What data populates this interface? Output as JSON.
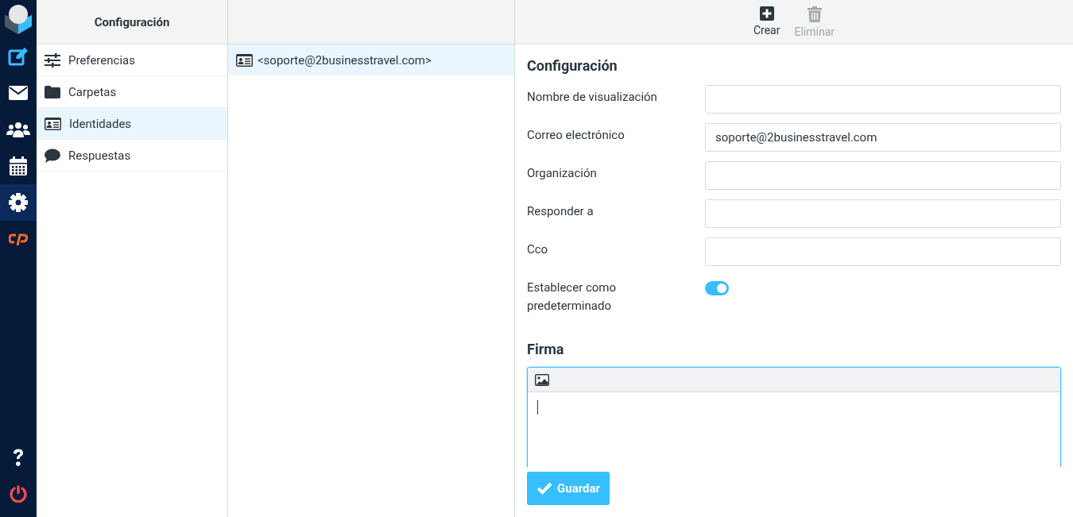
{
  "nav": [
    {
      "kind": "compose",
      "selected": false
    },
    {
      "kind": "mail",
      "selected": false
    },
    {
      "kind": "contacts",
      "selected": false
    },
    {
      "kind": "calendar",
      "selected": false
    },
    {
      "kind": "settings",
      "selected": true
    },
    {
      "kind": "cpanel",
      "selected": false
    }
  ],
  "nav_bottom": [
    {
      "kind": "help"
    },
    {
      "kind": "logout"
    }
  ],
  "settings": {
    "title": "Configuración",
    "items": [
      {
        "kind": "preferences",
        "label": "Preferencias",
        "selected": false
      },
      {
        "kind": "folders",
        "label": "Carpetas",
        "selected": false
      },
      {
        "kind": "identities",
        "label": "Identidades",
        "selected": true
      },
      {
        "kind": "responses",
        "label": "Respuestas",
        "selected": false
      }
    ]
  },
  "identities": [
    {
      "label": "<soporte@2businesstravel.com>",
      "selected": true
    }
  ],
  "toolbar": [
    {
      "kind": "create",
      "label": "Crear",
      "disabled": false
    },
    {
      "kind": "delete",
      "label": "Eliminar",
      "disabled": true
    }
  ],
  "form": {
    "title": "Configuración",
    "fields": [
      {
        "kind": "text",
        "label": "Nombre de visualización"
      },
      {
        "kind": "text",
        "label": "Correo electrónico",
        "value": "soporte@2businesstravel.com"
      },
      {
        "kind": "text",
        "label": "Organización"
      },
      {
        "kind": "text",
        "label": "Responder a"
      },
      {
        "kind": "text",
        "label": "Cco"
      },
      {
        "kind": "toggle",
        "label": "Establecer como predeterminado",
        "on": true
      }
    ],
    "signature_title": "Firma"
  },
  "save_button": "Guardar"
}
